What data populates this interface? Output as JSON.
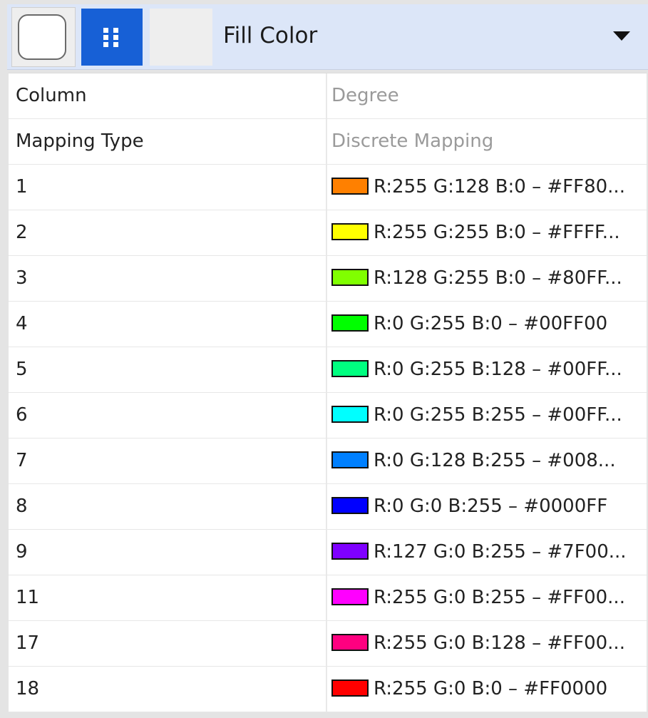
{
  "header": {
    "title": "Fill Color",
    "buttons": [
      {
        "name": "default-value",
        "icon": "white-rounded-square-icon"
      },
      {
        "name": "mapping",
        "icon": "dots-grid-icon",
        "active": true,
        "color": "#1760d6"
      },
      {
        "name": "bypass",
        "icon": "blank"
      }
    ]
  },
  "properties": {
    "column_label": "Column",
    "column_value": "Degree",
    "mapping_type_label": "Mapping Type",
    "mapping_type_value": "Discrete Mapping"
  },
  "mappings": [
    {
      "key": "1",
      "color": "#FF8000",
      "text": "R:255 G:128 B:0 – #FF80..."
    },
    {
      "key": "2",
      "color": "#FFFF00",
      "text": "R:255 G:255 B:0 – #FFFF..."
    },
    {
      "key": "3",
      "color": "#80FF00",
      "text": "R:128 G:255 B:0 – #80FF..."
    },
    {
      "key": "4",
      "color": "#00FF00",
      "text": "R:0 G:255 B:0 – #00FF00"
    },
    {
      "key": "5",
      "color": "#00FF80",
      "text": "R:0 G:255 B:128 – #00FF..."
    },
    {
      "key": "6",
      "color": "#00FFFF",
      "text": "R:0 G:255 B:255 – #00FF..."
    },
    {
      "key": "7",
      "color": "#0080FF",
      "text": "R:0 G:128 B:255 – #008..."
    },
    {
      "key": "8",
      "color": "#0000FF",
      "text": "R:0 G:0 B:255 – #0000FF"
    },
    {
      "key": "9",
      "color": "#7F00FF",
      "text": "R:127 G:0 B:255 – #7F00..."
    },
    {
      "key": "11",
      "color": "#FF00FF",
      "text": "R:255 G:0 B:255 – #FF00..."
    },
    {
      "key": "17",
      "color": "#FF0080",
      "text": "R:255 G:0 B:128 – #FF00..."
    },
    {
      "key": "18",
      "color": "#FF0000",
      "text": "R:255 G:0 B:0 – #FF0000"
    }
  ]
}
